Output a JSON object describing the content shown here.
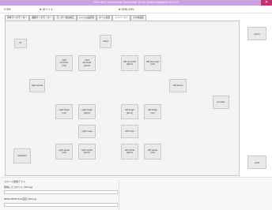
{
  "window": {
    "title": "RCB-4HV Command Generator UI for Robot Network Ver.1.0",
    "close_glyph": "✕"
  },
  "selectors": {
    "port_label": "COM",
    "port_value": "ポート1",
    "mode_label": "",
    "mode_value": "KHR-3HV",
    "caret": "▼"
  },
  "tabs": [
    {
      "label": "単体サーボモーター"
    },
    {
      "label": "複数サーボモーター"
    },
    {
      "label": "ランダー版出補正"
    },
    {
      "label": "ジャイロ設定値"
    },
    {
      "label": "ホーム位置"
    },
    {
      "label": "スイバーマイ"
    },
    {
      "label": "その他設定"
    }
  ],
  "servo_buttons": {
    "s1": "S1",
    "head": "head",
    "right_shoulder_roll": "right\nshoulder\n(roll)",
    "right_shoulder_pitch": "right\nshoulder\n(pitch)",
    "left_shoulder_pitch": "left shoulder\n(pitch)",
    "left_shoulder_roll": "left shoulder\n(roll)",
    "right_elbow": "right elbow",
    "left_elbow": "left elbow",
    "right_thigh_roll": "right thigh\n(roll)",
    "right_thigh_pitch": "right thigh\n(pitch)",
    "left_thigh_pitch": "left thigh\n(pitch)",
    "left_thigh_roll": "left thigh\n(roll)",
    "right_knee": "right knee",
    "left_knee": "left knee",
    "waistsail": "waistsail",
    "right_ankle_roll": "right ankle\n(roll)",
    "right_ankle_pitch": "right ankle\n(pitch)",
    "left_ankle_pitch": "left ankle\n(pitch)",
    "left_ankle_roll": "left ankle\n(roll)",
    "lucostar": "lucostar"
  },
  "side_buttons": {
    "open": "open",
    "exit": "exit"
  },
  "bottom": {
    "section_label": "コマンド送信テスト",
    "field1_label": "受信したコマンド (String)",
    "field2_label": "REVA-MHD Hub直接 (String)",
    "field1_value": "",
    "field2_value": ""
  }
}
